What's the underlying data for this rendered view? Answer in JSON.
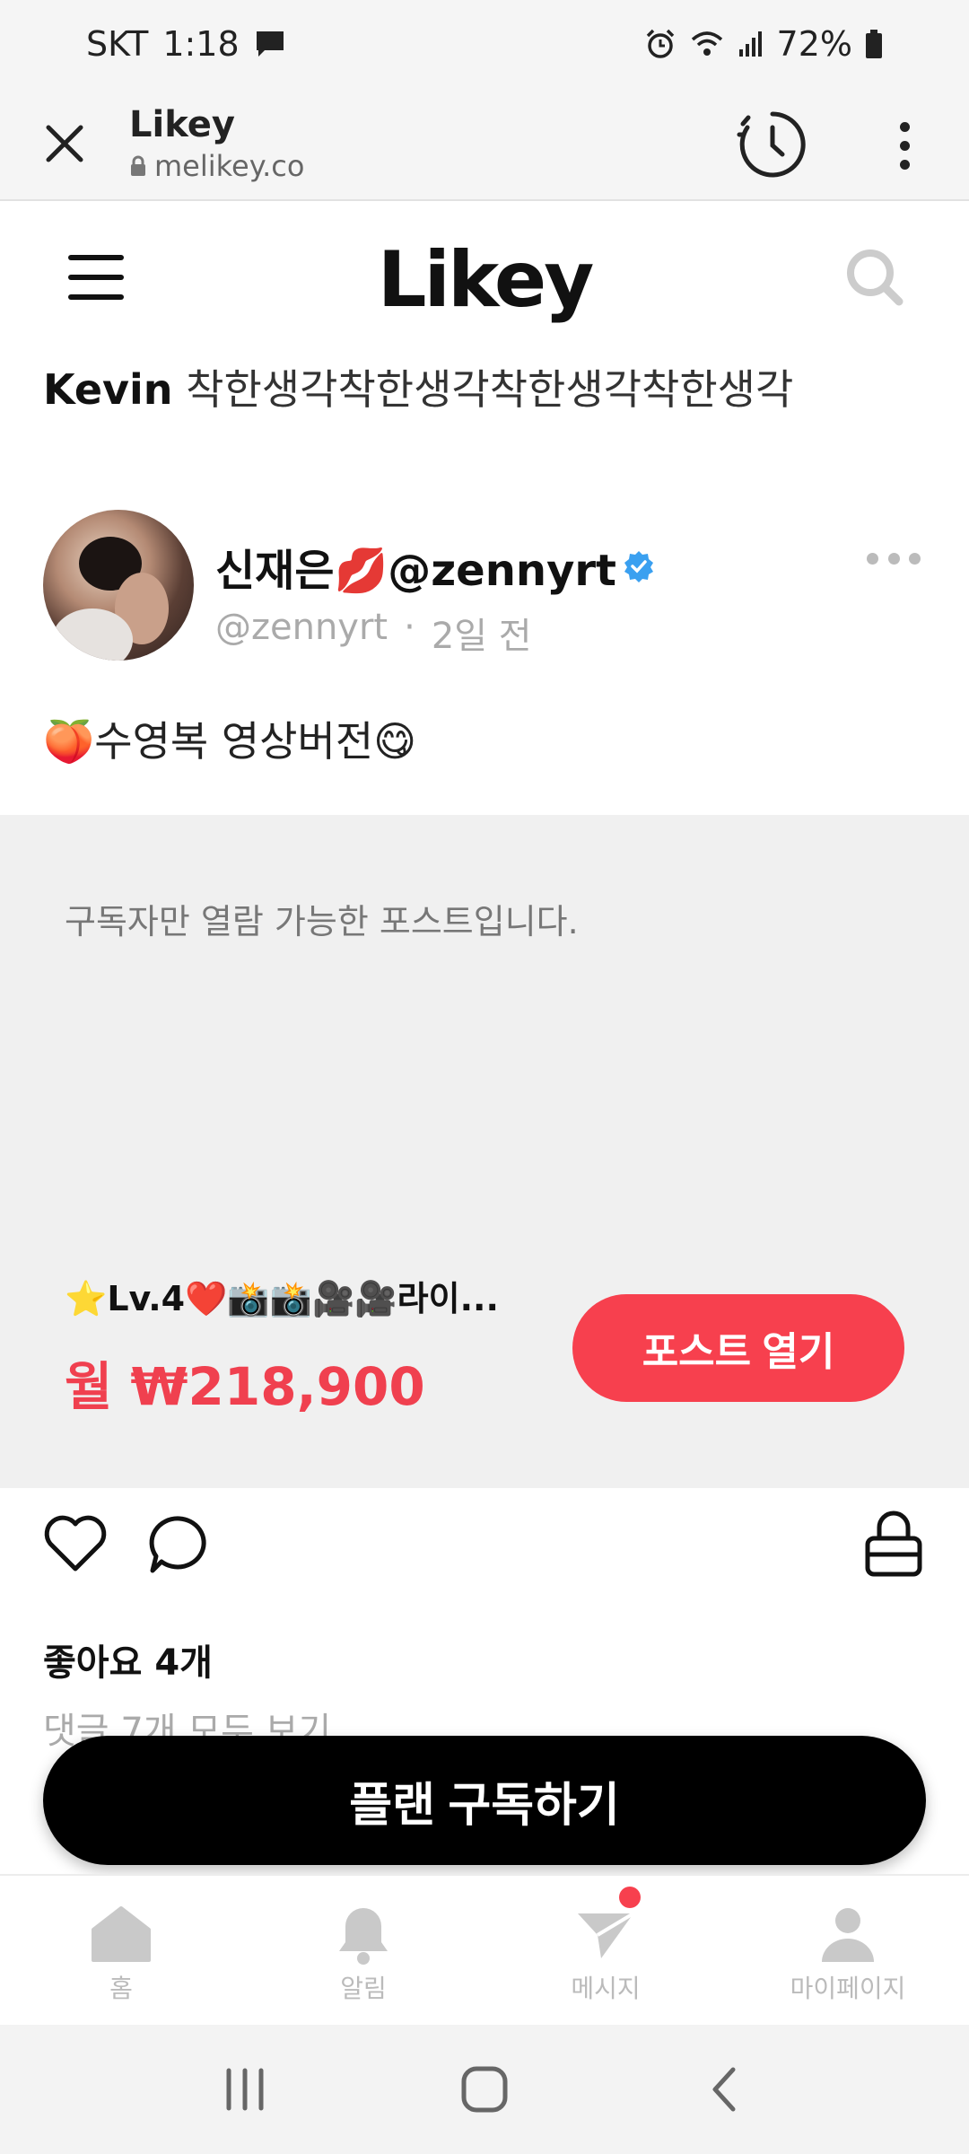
{
  "status_bar": {
    "carrier": "SKT",
    "time": "1:18",
    "battery": "72%",
    "icons": [
      "message-icon",
      "alarm-icon",
      "wifi-icon",
      "signal-icon",
      "battery-icon"
    ]
  },
  "browser": {
    "title": "Likey",
    "url": "melikey.co"
  },
  "site": {
    "logo": "Likey",
    "greeting_name": "Kevin",
    "greeting_text": "착한생각착한생각착한생각착한생각"
  },
  "post": {
    "author_name": "신재은💋@zennyrt",
    "handle": "@zennyrt",
    "time_ago": "2일 전",
    "caption": "🍑수영복 영상버전😋",
    "locked_message": "구독자만 열람 가능한 포스트입니다.",
    "plan_name": "⭐Lv.4❤️📸📸🎥🎥라이...",
    "plan_price": "월 ₩218,900",
    "open_button": "포스트 열기",
    "likes": "좋아요 4개",
    "comments_link": "댓글 7개 모두 보기"
  },
  "subscribe_button": "플랜 구독하기",
  "bottom_nav": {
    "home": "홈",
    "alerts": "알림",
    "messages": "메시지",
    "mypage": "마이페이지"
  },
  "colors": {
    "accent": "#f7404e",
    "price": "#f0404f",
    "verified": "#3aa0f0",
    "locked_bg": "#f0f0f0"
  }
}
